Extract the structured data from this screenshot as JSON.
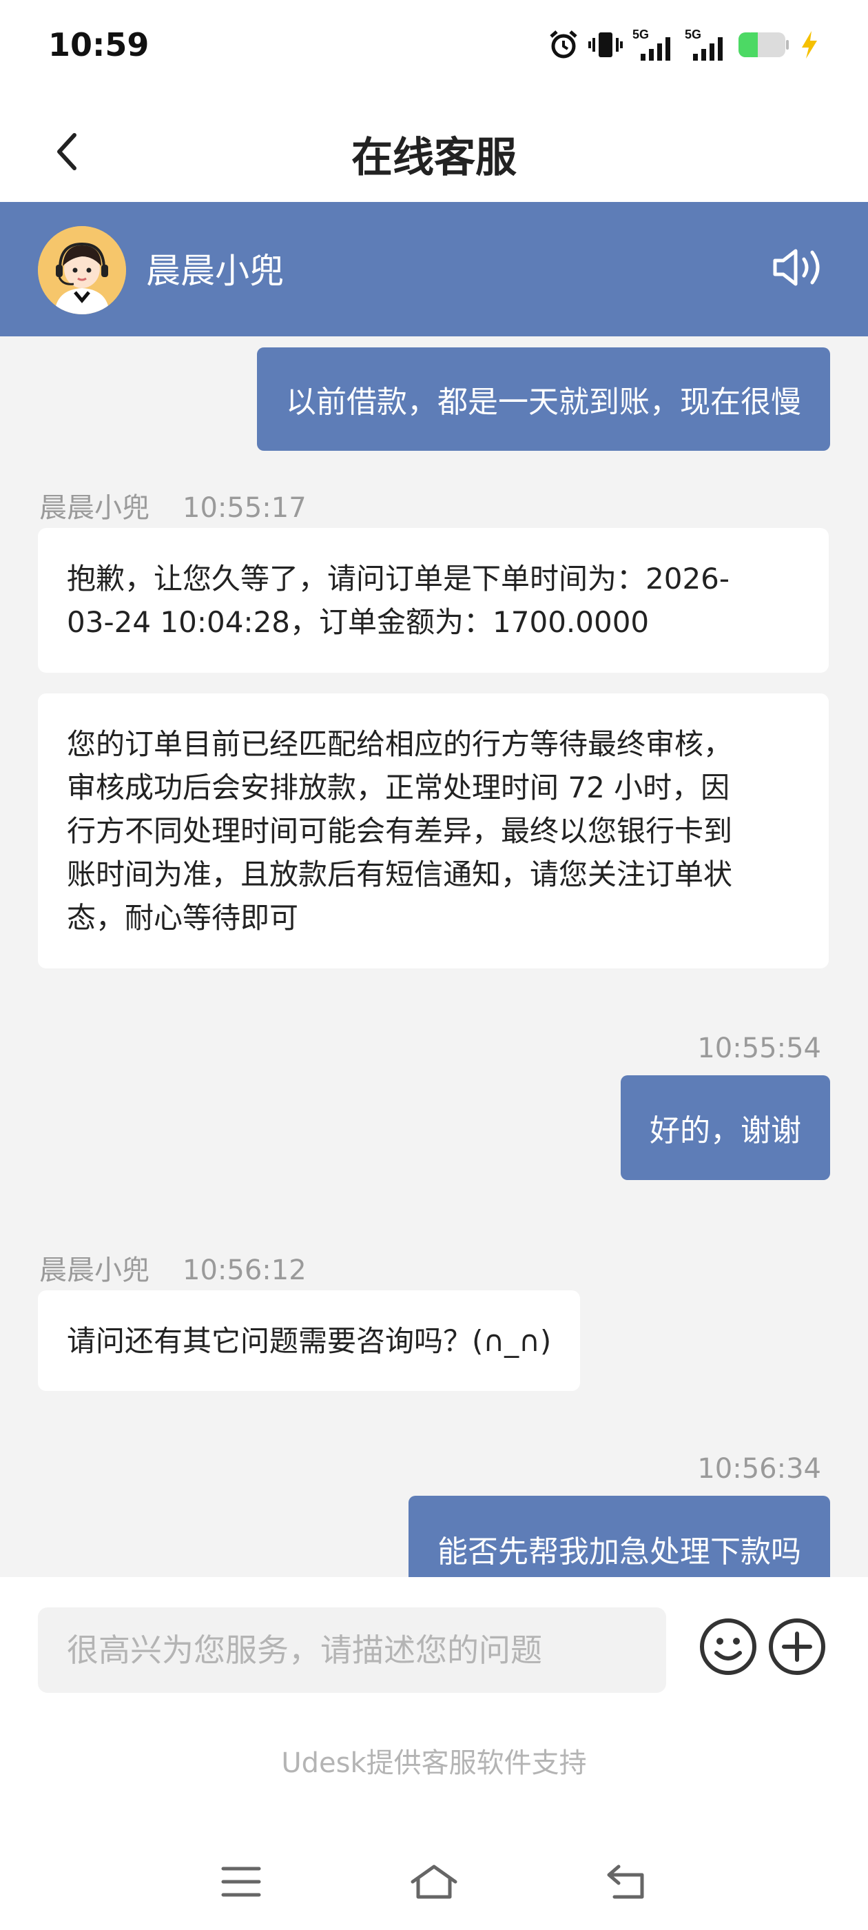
{
  "status_bar": {
    "time": "10:59",
    "icons": [
      "alarm-icon",
      "vibrate-icon",
      "signal-5g-icon",
      "signal-5g-icon",
      "battery-icon",
      "charging-icon"
    ],
    "network_1": "5G",
    "network_2": "5G",
    "battery_color": "#4cd964"
  },
  "header": {
    "title": "在线客服",
    "back_icon": "chevron-left-icon"
  },
  "agent": {
    "name": "晨晨小兜",
    "bar_color": "#5e7db7",
    "speaker_icon": "speaker-icon"
  },
  "messages": [
    {
      "from": "user",
      "text": "以前借款，都是一天就到账，现在很慢"
    },
    {
      "from": "agent",
      "sender": "晨晨小兜",
      "time": "10:55:17",
      "lines": [
        "抱歉，让您久等了，请问订单是下单时间为：2026-",
        "03-24 10:04:28，订单金额为：1700.0000"
      ]
    },
    {
      "from": "agent",
      "lines": [
        "您的订单目前已经匹配给相应的行方等待最终审核，",
        "审核成功后会安排放款，正常处理时间 72 小时，因",
        "行方不同处理时间可能会有差异，最终以您银行卡到",
        "账时间为准，且放款后有短信通知，请您关注订单状",
        "态，耐心等待即可"
      ]
    },
    {
      "from": "user",
      "time": "10:55:54",
      "text": "好的，谢谢"
    },
    {
      "from": "agent",
      "sender": "晨晨小兜",
      "time": "10:56:12",
      "text": "请问还有其它问题需要咨询吗？(∩_∩)"
    },
    {
      "from": "user",
      "time": "10:56:34",
      "text": "能否先帮我加急处理下款吗"
    }
  ],
  "input": {
    "placeholder": "很高兴为您服务，请描述您的问题",
    "value": ""
  },
  "footer": {
    "powered_by": "Udesk提供客服软件支持"
  },
  "nav": {
    "icons": [
      "menu-icon",
      "home-icon",
      "back-icon"
    ]
  }
}
